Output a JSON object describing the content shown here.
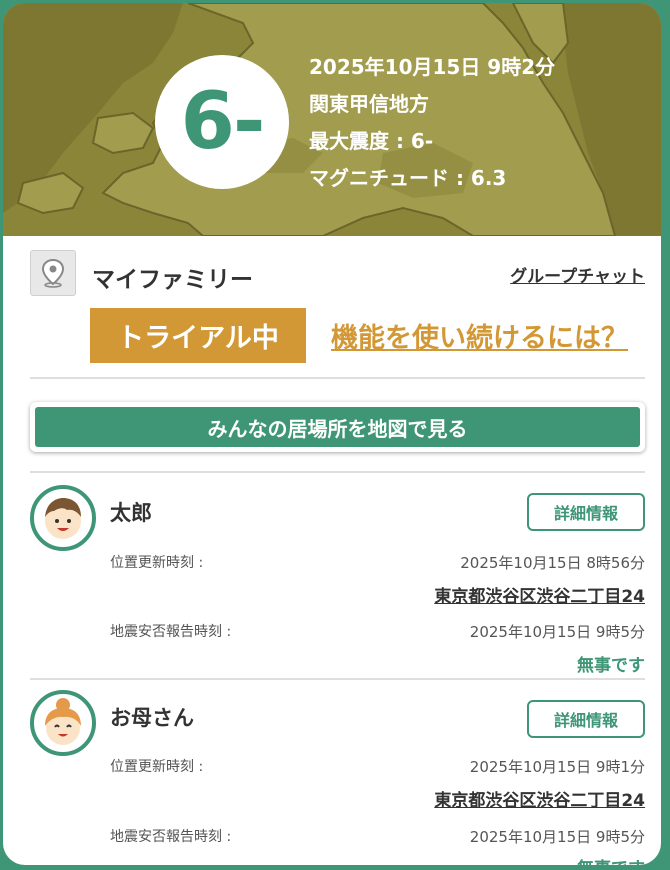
{
  "hero": {
    "intensity": "6-",
    "datetime": "2025年10月15日 9時2分",
    "region": "関東甲信地方",
    "max_intensity": "最大震度 : 6-",
    "magnitude": "マグニチュード : 6.3"
  },
  "family": {
    "title": "マイファミリー",
    "group_chat": "グループチャット",
    "pin_icon": "map-pin-icon"
  },
  "trial": {
    "badge": "トライアル中",
    "link": "機能を使い続けるには？"
  },
  "map_button": "みんなの居場所を地図で見る",
  "members": [
    {
      "name": "太郎",
      "detail_button": "詳細情報",
      "location_label": "位置更新時刻 :",
      "location_time": "2025年10月15日 8時56分",
      "address": "東京都渋谷区渋谷二丁目24",
      "report_label": "地震安否報告時刻 :",
      "report_time": "2025年10月15日 9時5分",
      "status": "無事です",
      "avatar_icon": "boy-avatar-icon"
    },
    {
      "name": "お母さん",
      "detail_button": "詳細情報",
      "location_label": "位置更新時刻 :",
      "location_time": "2025年10月15日 9時1分",
      "address": "東京都渋谷区渋谷二丁目24",
      "report_label": "地震安否報告時刻 :",
      "report_time": "2025年10月15日 9時5分",
      "status": "無事です",
      "avatar_icon": "mother-avatar-icon"
    }
  ],
  "colors": {
    "brand_green": "#3e9677",
    "trial_orange": "#d39836",
    "map_olive": "#8f8a3e"
  }
}
